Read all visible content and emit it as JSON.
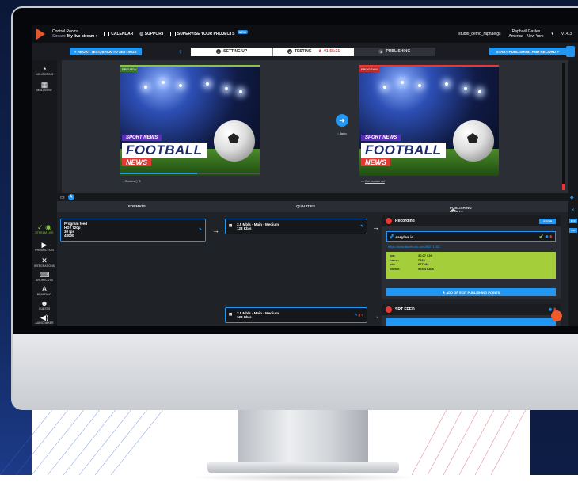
{
  "app": {
    "title": "Control Rooms",
    "stream_name": "My live stream",
    "stream_prefix": "Stream:",
    "version": "V14.3"
  },
  "topbar": {
    "calendar": "CALENDAR",
    "support": "SUPPORT",
    "supervise": "SUPERVISE YOUR PROJECTS",
    "new_badge": "NEW",
    "studio": "studio_demo_raphaelgs",
    "user_name": "Raphaël Gasles",
    "user_tz": "America - New York"
  },
  "subbar": {
    "abort_button": "« ABORT TEST, BACK TO SETTINGS",
    "steps": [
      {
        "num": "1",
        "label": "SETTING UP"
      },
      {
        "num": "2",
        "label": "TESTING"
      },
      {
        "num": "3",
        "label": "PUBLISHING"
      }
    ],
    "timer": "01:55:21",
    "start_button": "START PUBLISHING AND RECORD »"
  },
  "sidebar": {
    "items": [
      {
        "label": "MONITORING",
        "icon": "gauge-icon"
      },
      {
        "label": "MULTIVIEW",
        "icon": "grid-icon"
      },
      {
        "label": "STREAM LIVE",
        "icon": "signal-icon"
      },
      {
        "label": "PRODUCTION",
        "icon": "camera-icon"
      },
      {
        "label": "INTEGRATIONS",
        "icon": "tools-icon"
      },
      {
        "label": "SHORTCUTS",
        "icon": "keyboard-icon"
      },
      {
        "label": "BRANDING",
        "icon": "text-icon"
      },
      {
        "label": "GUESTS",
        "icon": "users-icon"
      },
      {
        "label": "AUDIO MIXER",
        "icon": "speaker-icon"
      }
    ]
  },
  "preview": {
    "left_tag": "PREVIEW",
    "right_tag": "PROGRAM",
    "lower_third": {
      "line1": "SPORT NEWS",
      "line2": "FOOTBALL",
      "line3": "NEWS"
    },
    "auto_label": "Auto",
    "guides_label": "Guides",
    "isolate_label": "Get Isolate url",
    "progress_value": 0.55
  },
  "panel": {
    "formats_header": "FORMATS",
    "qualities_header": "QUALITIES",
    "publishing_header": "PUBLISHING POINTS",
    "format_card": {
      "line1": "Program feed",
      "line2": "HD / 720p",
      "line3": "30 fps",
      "line4": "48000"
    },
    "quality_card_1": {
      "line1": "3.5 Mb/s - Main - Medium",
      "line2": "128 Kb/s"
    },
    "quality_card_2": {
      "line1": "3.5 Mb/s - Main - Medium",
      "line2": "128 Kb/s"
    },
    "recording": {
      "title": "Recording",
      "stop_button": "STOP",
      "destination": "easylive.io",
      "url": "https://www.facebook.com/86271182...",
      "stats": [
        {
          "k": "fps:",
          "v": "30.07 / 30"
        },
        {
          "k": "frame:",
          "v": "7900"
        },
        {
          "k": "pkt:",
          "v": "277143"
        },
        {
          "k": "bitrate:",
          "v": "965.4 Kb/s"
        }
      ],
      "add_button": "ADD OR EDIT PUBLISHING POINTS"
    },
    "srt": {
      "title": "SRT FEED"
    }
  },
  "rail": {
    "btn1": "EXP.",
    "btn2": "IMP."
  }
}
